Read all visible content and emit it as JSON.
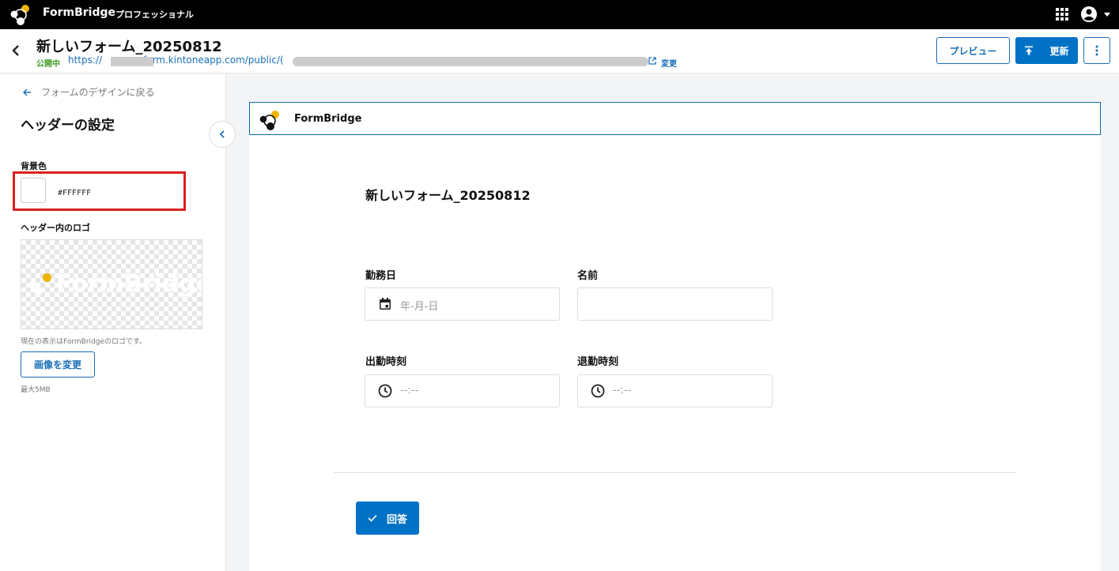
{
  "topbar": {
    "brand": "FormBridge",
    "plan": "プロフェッショナル",
    "icons": [
      "formbridge-logo-icon",
      "apps-grid-icon",
      "account-circle-icon",
      "caret-down-icon"
    ]
  },
  "header": {
    "form_title": "新しいフォーム_20250812",
    "status": "公開中",
    "url_prefix": "https://",
    "url_domain": "form.kintoneapp.com/public/",
    "url_suffix": "(",
    "change_link": "変更",
    "preview_button": "プレビュー",
    "update_button": "更新",
    "icons": [
      "back-arrow-icon",
      "external-link-icon",
      "upload-icon",
      "more-vertical-icon"
    ]
  },
  "side": {
    "back_link": "フォームのデザインに戻る",
    "title": "ヘッダーの設定",
    "bg_label": "背景色",
    "bg_color_value": "#FFFFFF",
    "logo_label": "ヘッダー内のロゴ",
    "logo_watermark": "FormBridge",
    "logo_note": "現在の表示はFormBridgeのロゴです。",
    "change_image_button": "画像を変更",
    "max_size": "最大5MB",
    "highlight_color": "#d9211f"
  },
  "preview": {
    "header_brand": "FormBridge",
    "header_border_color": "#0a6aa9",
    "form_title": "新しいフォーム_20250812",
    "fields": [
      {
        "label": "勤務日",
        "placeholder": "年-月-日",
        "icon": "calendar-icon"
      },
      {
        "label": "名前",
        "placeholder": "",
        "icon": ""
      },
      {
        "label": "出勤時刻",
        "placeholder": "--:--",
        "icon": "clock-icon"
      },
      {
        "label": "退勤時刻",
        "placeholder": "--:--",
        "icon": "clock-icon"
      }
    ],
    "submit_button": "回答"
  },
  "colors": {
    "accent": "#0072c5",
    "link": "#1a6eb8",
    "status_green": "#3c9b20",
    "logo_yellow": "#f0b400"
  }
}
